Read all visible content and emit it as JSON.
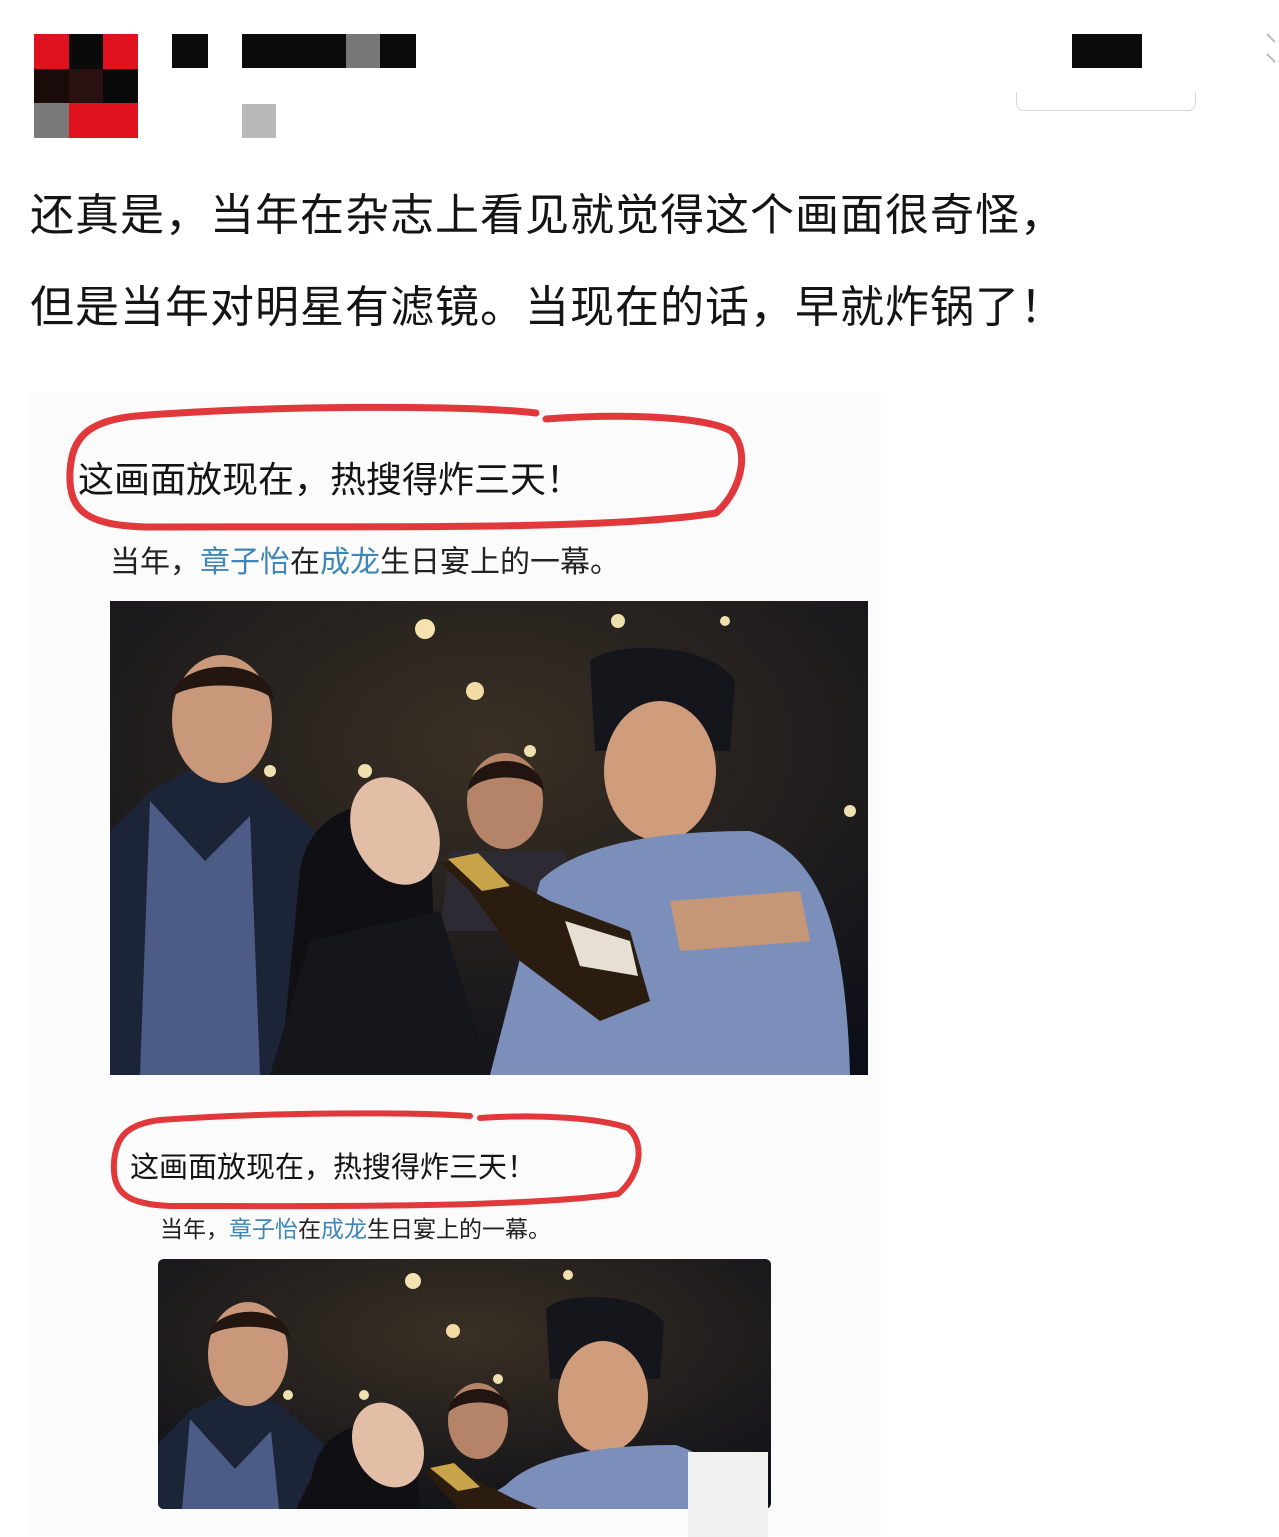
{
  "post": {
    "text_lines": [
      "还真是，当年在杂志上看见就觉得这个画面很奇怪，",
      "但是当年对明星有滤镜。当现在的话，早就炸锅了！"
    ]
  },
  "attachment": {
    "panels": [
      {
        "headline": "这画面放现在，热搜得炸三天！",
        "caption": {
          "prefix": "当年，",
          "name1": "章子怡",
          "mid": "在",
          "name2": "成龙",
          "suffix": "生日宴上的一幕。"
        }
      },
      {
        "headline": "这画面放现在，热搜得炸三天！",
        "caption": {
          "prefix": "当年，",
          "name1": "章子怡",
          "mid": "在",
          "name2": "成龙",
          "suffix": "生日宴上的一幕。"
        }
      }
    ]
  },
  "colors": {
    "highlight_circle": "#e0383b",
    "name_link": "#3f86b6",
    "text": "#141414"
  },
  "icons": {
    "menu": "chevron-down-icon"
  }
}
